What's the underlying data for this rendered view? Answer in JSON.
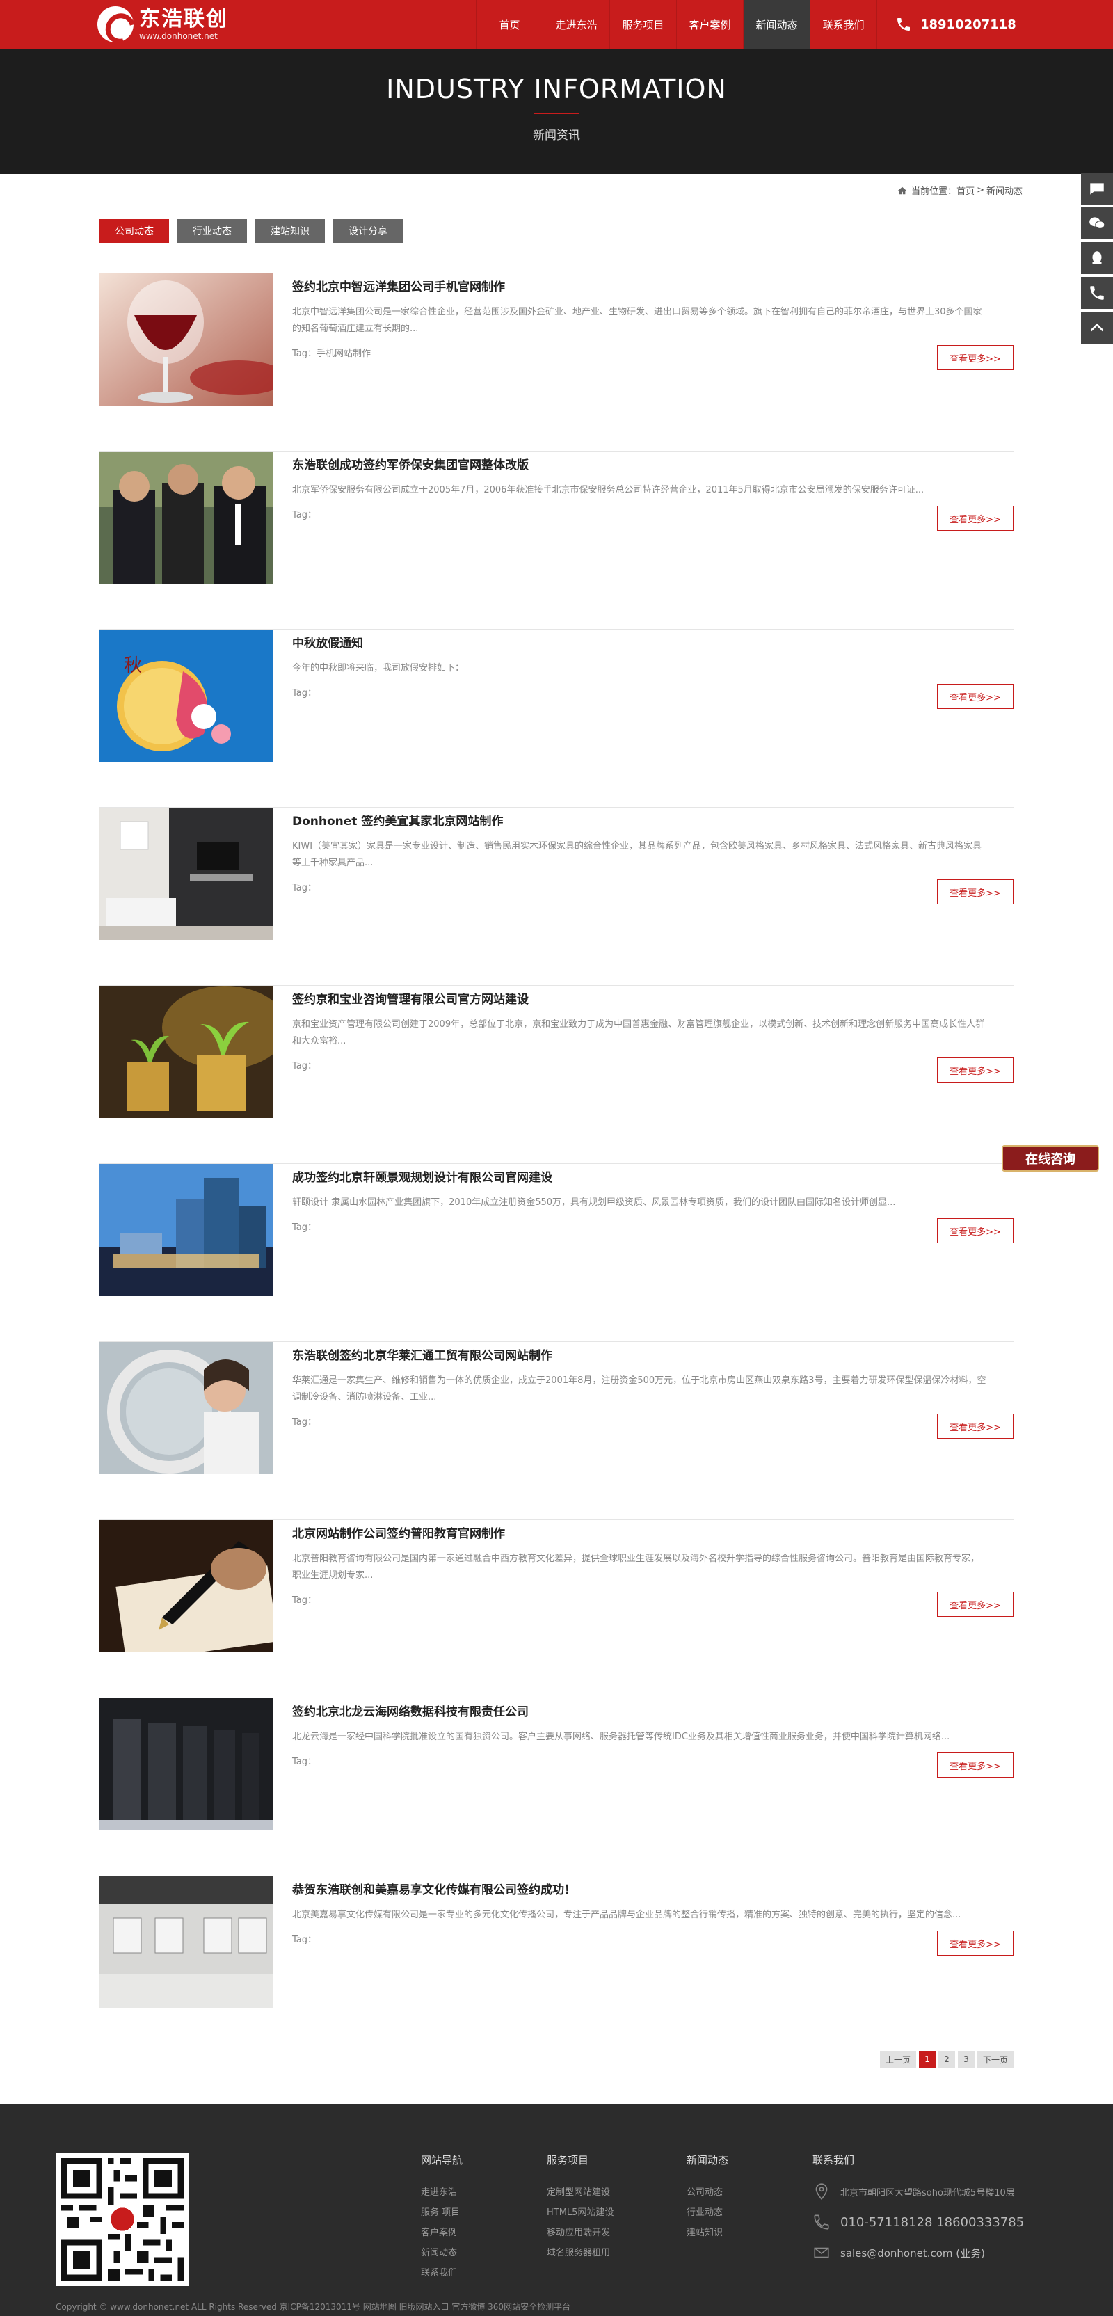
{
  "header": {
    "logo_cn": "东浩联创",
    "logo_url": "www.donhonet.net",
    "nav": [
      "首页",
      "走进东浩",
      "服务项目",
      "客户案例",
      "新闻动态",
      "联系我们"
    ],
    "active_nav": 4,
    "phone": "18910207118"
  },
  "banner": {
    "title": "INDUSTRY INFORMATION",
    "subtitle": "新闻资讯"
  },
  "breadcrumb": {
    "prefix": "当前位置：",
    "home": "首页",
    "sep": ">",
    "current": "新闻动态"
  },
  "tabs": [
    "公司动态",
    "行业动态",
    "建站知识",
    "设计分享"
  ],
  "more_label": "查看更多>>",
  "news": [
    {
      "title": "签约北京中智远洋集团公司手机官网制作",
      "desc": "北京中智远洋集团公司是一家综合性企业，经营范围涉及国外金矿业、地产业、生物研发、进出口贸易等多个领域。旗下在智利拥有自己的菲尔帝酒庄，与世界上30多个国家的知名葡萄酒庄建立有长期的...",
      "tag": "Tag：手机网站制作"
    },
    {
      "title": "东浩联创成功签约军侨保安集团官网整体改版",
      "desc": "北京军侨保安服务有限公司成立于2005年7月，2006年获准接手北京市保安服务总公司特许经营企业，2011年5月取得北京市公安局颁发的保安服务许可证...",
      "tag": "Tag："
    },
    {
      "title": "中秋放假通知",
      "desc": "今年的中秋即将来临，我司放假安排如下：",
      "tag": "Tag："
    },
    {
      "title": "Donhonet 签约美宜其家北京网站制作",
      "desc": "KIWI（美宜其家）家具是一家专业设计、制造、销售民用实木环保家具的综合性企业，其品牌系列产品，包含欧美风格家具、乡村风格家具、法式风格家具、新古典风格家具等上千种家具产品...",
      "tag": "Tag："
    },
    {
      "title": "签约京和宝业咨询管理有限公司官方网站建设",
      "desc": "京和宝业资产管理有限公司创建于2009年，总部位于北京，京和宝业致力于成为中国普惠金融、财富管理旗舰企业，以模式创新、技术创新和理念创新服务中国高成长性人群和大众富裕...",
      "tag": "Tag："
    },
    {
      "title": "成功签约北京轩颐景观规划设计有限公司官网建设",
      "desc": "轩颐设计 隶属山水园林产业集团旗下，2010年成立注册资金550万，具有规划甲级资质、风景园林专项资质，我们的设计团队由国际知名设计师创显...",
      "tag": "Tag："
    },
    {
      "title": "东浩联创签约北京华莱汇通工贸有限公司网站制作",
      "desc": "华莱汇通是一家集生产、维修和销售为一体的优质企业，成立于2001年8月，注册资金500万元，位于北京市房山区燕山双泉东路3号，主要着力研发环保型保温保冷材料，空调制冷设备、消防喷淋设备、工业...",
      "tag": "Tag："
    },
    {
      "title": "北京网站制作公司签约普阳教育官网制作",
      "desc": "北京普阳教育咨询有限公司是国内第一家通过融合中西方教育文化差异，提供全球职业生涯发展以及海外名校升学指导的综合性服务咨询公司。普阳教育是由国际教育专家，职业生涯规划专家...",
      "tag": "Tag："
    },
    {
      "title": "签约北京北龙云海网络数据科技有限责任公司",
      "desc": "北龙云海是一家经中国科学院批准设立的国有独资公司。客户主要从事网络、服务器托管等传统IDC业务及其相关增值性商业服务业务，并使中国科学院计算机网络...",
      "tag": "Tag："
    },
    {
      "title": "恭贺东浩联创和美嘉易享文化传媒有限公司签约成功！",
      "desc": "北京美嘉易享文化传媒有限公司是一家专业的多元化文化传播公司，专注于产品品牌与企业品牌的整合行销传播，精准的方案、独特的创意、完美的执行，坚定的信念...",
      "tag": "Tag："
    }
  ],
  "pagination": [
    "上一页",
    "1",
    "2",
    "3",
    "下一页"
  ],
  "consult_label": "在线咨询",
  "footer": {
    "cols": [
      {
        "title": "网站导航",
        "links": [
          "走进东浩",
          "服务 项目",
          "客户案例",
          "新闻动态",
          "联系我们"
        ]
      },
      {
        "title": "服务项目",
        "links": [
          "定制型网站建设",
          "HTML5网站建设",
          "移动应用端开发",
          "域名服务器租用"
        ]
      },
      {
        "title": "新闻动态",
        "links": [
          "公司动态",
          "行业动态",
          "建站知识"
        ]
      }
    ],
    "contact_title": "联系我们",
    "address": "北京市朝阳区大望路soho现代城5号楼10层",
    "phones": "010-57118128 18600333785",
    "email": "sales@donhonet.com (业务)",
    "copyright": "Copyright © www.donhonet.net ALL Rights Reserved 京ICP备12013011号  网站地图  旧版网站入口  官方微博 360网站安全检测平台"
  },
  "colors": {
    "brand": "#c81c1c",
    "dark": "#1d1d1d",
    "footer": "#2c2c2c"
  }
}
